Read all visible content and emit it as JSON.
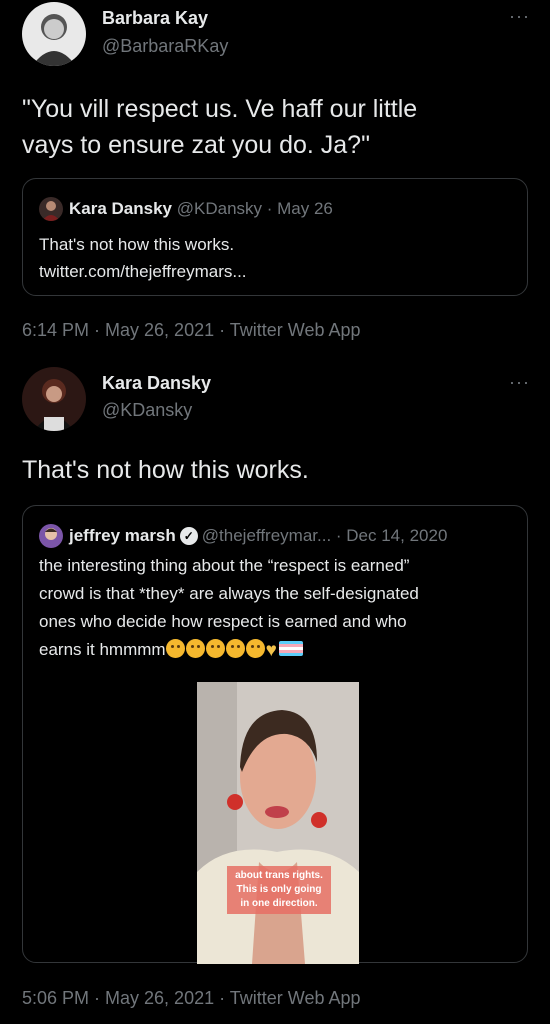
{
  "tweet1": {
    "name": "Barbara Kay",
    "handle": "@BarbaraRKay",
    "text_line1": "\"You vill respect us. Ve haff our little",
    "text_line2": "vays to ensure zat you do. Ja?\"",
    "more": "···",
    "quote": {
      "name": "Kara Dansky",
      "meta": "@KDansky · May 26",
      "line1": "That's not how this works.",
      "line2": "twitter.com/thejeffreymars..."
    },
    "timestamp": "6:14 PM · May 26, 2021 · Twitter Web App"
  },
  "tweet2": {
    "name": "Kara Dansky",
    "handle": "@KDansky",
    "text": "That's not how this works.",
    "more": "···",
    "quote": {
      "name": "jeffrey marsh",
      "meta": "@thejeffreymar... · Dec 14, 2020",
      "line1": "the interesting thing about the “respect is earned”",
      "line2": "crowd is that *they* are always the self-designated",
      "line3": "ones who decide how respect is earned and who",
      "line4": "earns it hmmmm",
      "video_caption_1": "about trans rights.",
      "video_caption_2": "This is only going",
      "video_caption_3": "in one direction."
    },
    "timestamp": "5:06 PM · May 26, 2021 · Twitter Web App"
  }
}
